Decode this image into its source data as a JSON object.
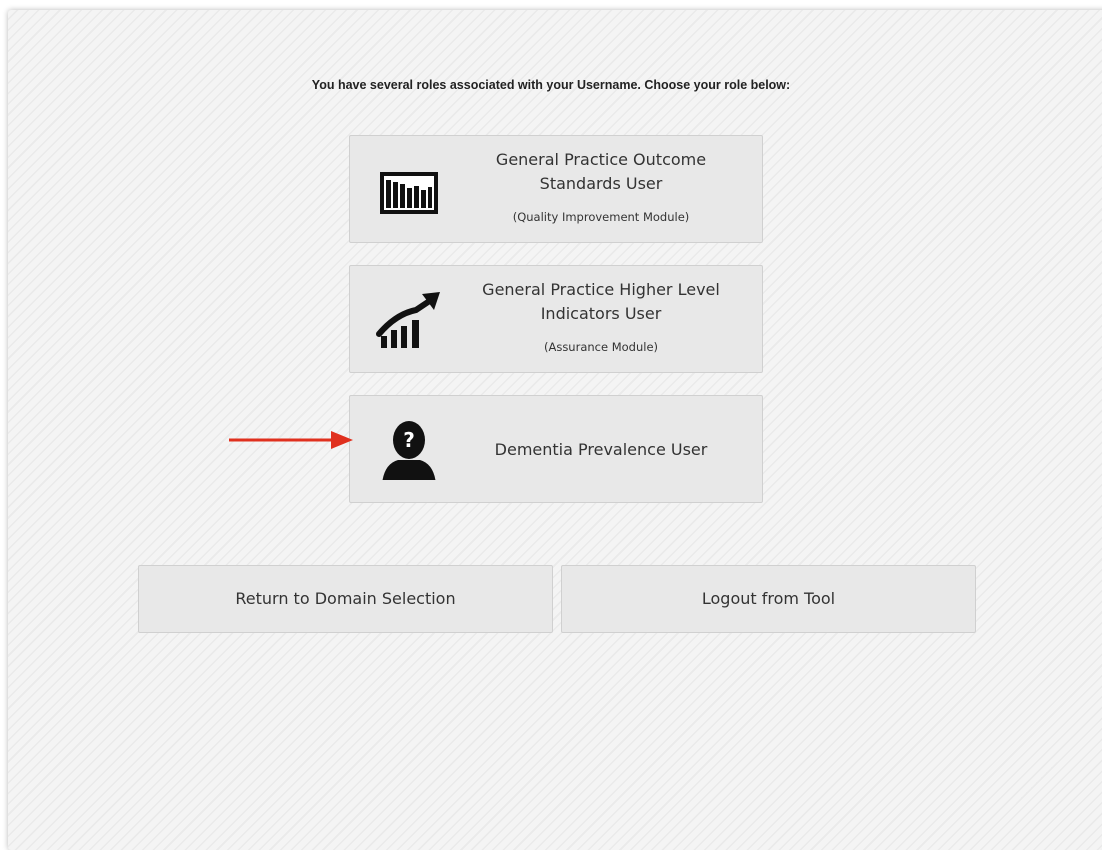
{
  "prompt": "You have several roles associated with your Username. Choose your role below:",
  "roles": [
    {
      "icon": "bar-chart-icon",
      "title_line1": "General Practice Outcome",
      "title_line2": "Standards User",
      "subtitle": "(Quality Improvement Module)"
    },
    {
      "icon": "trending-up-chart-icon",
      "title_line1": "General Practice Higher Level",
      "title_line2": "Indicators User",
      "subtitle": "(Assurance Module)"
    },
    {
      "icon": "unknown-person-icon",
      "title": "Dementia Prevalence User"
    }
  ],
  "actions": {
    "return_label": "Return to Domain Selection",
    "logout_label": "Logout from Tool"
  },
  "colors": {
    "annotation_arrow": "#e0301e",
    "button_background": "#e8e8e8",
    "icon": "#111111"
  }
}
